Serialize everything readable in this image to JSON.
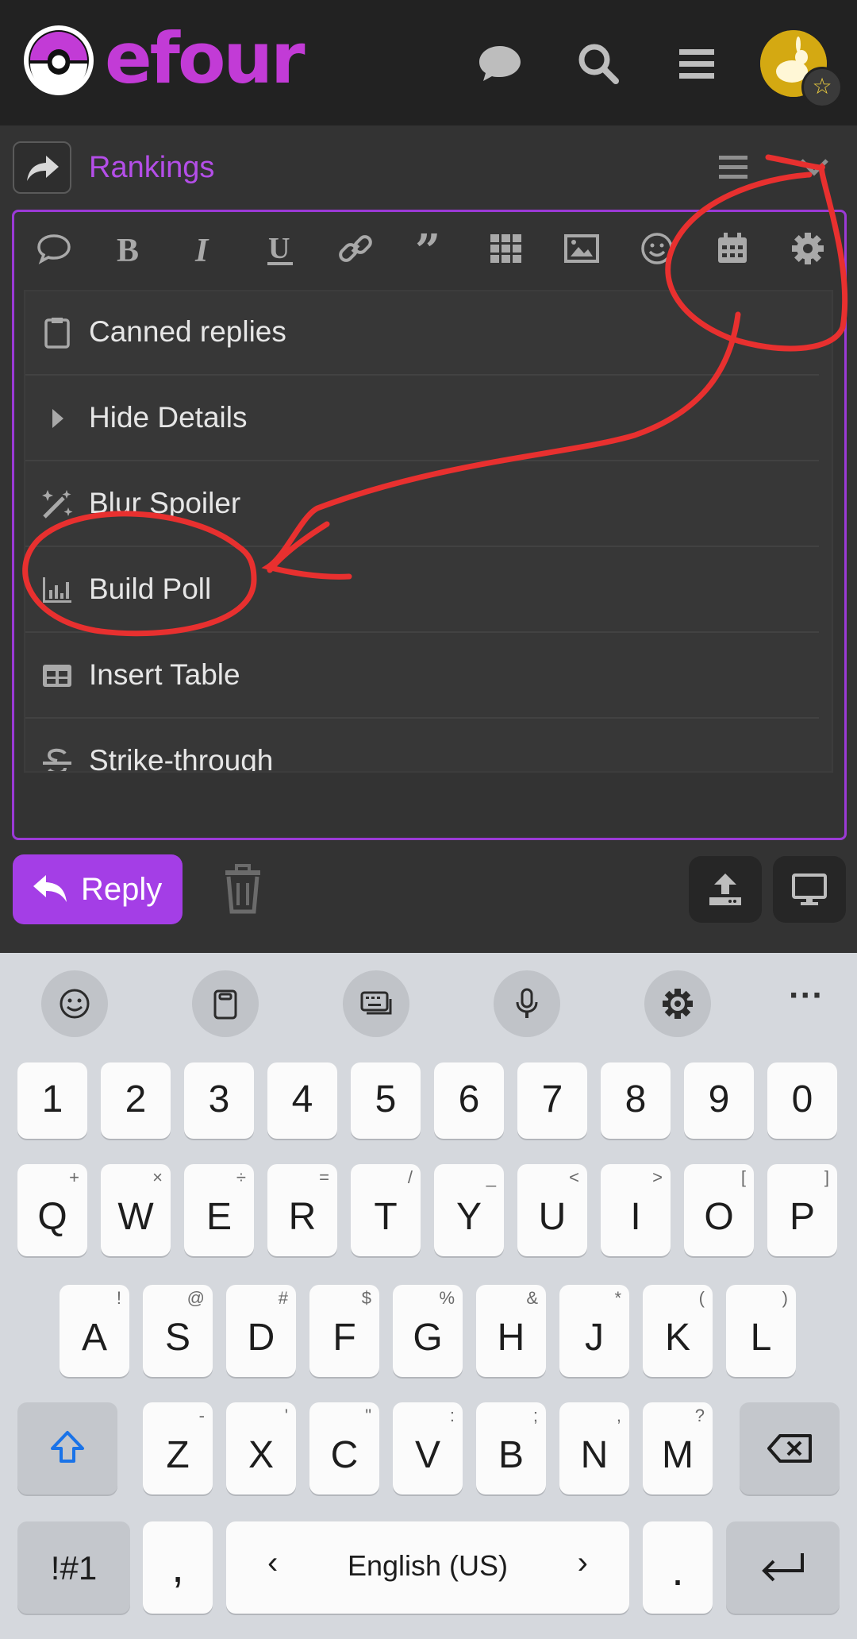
{
  "app": {
    "brand": "efour",
    "topic_title": "Rankings"
  },
  "composer_menu": {
    "items": [
      {
        "icon": "clipboard-icon",
        "label": "Canned replies"
      },
      {
        "icon": "caret-right-icon",
        "label": "Hide Details"
      },
      {
        "icon": "magic-wand-icon",
        "label": "Blur Spoiler"
      },
      {
        "icon": "bar-chart-icon",
        "label": "Build Poll"
      },
      {
        "icon": "table-icon",
        "label": "Insert Table"
      },
      {
        "icon": "strikethrough-icon",
        "label": "Strike-through"
      }
    ]
  },
  "actions": {
    "reply_label": "Reply"
  },
  "keyboard": {
    "numbers": [
      "1",
      "2",
      "3",
      "4",
      "5",
      "6",
      "7",
      "8",
      "9",
      "0"
    ],
    "row1": [
      {
        "k": "Q",
        "s": "+"
      },
      {
        "k": "W",
        "s": "×"
      },
      {
        "k": "E",
        "s": "÷"
      },
      {
        "k": "R",
        "s": "="
      },
      {
        "k": "T",
        "s": "/"
      },
      {
        "k": "Y",
        "s": "_"
      },
      {
        "k": "U",
        "s": "<"
      },
      {
        "k": "I",
        "s": ">"
      },
      {
        "k": "O",
        "s": "["
      },
      {
        "k": "P",
        "s": "]"
      }
    ],
    "row2": [
      {
        "k": "A",
        "s": "!"
      },
      {
        "k": "S",
        "s": "@"
      },
      {
        "k": "D",
        "s": "#"
      },
      {
        "k": "F",
        "s": "$"
      },
      {
        "k": "G",
        "s": "%"
      },
      {
        "k": "H",
        "s": "&"
      },
      {
        "k": "J",
        "s": "*"
      },
      {
        "k": "K",
        "s": "("
      },
      {
        "k": "L",
        "s": ")"
      }
    ],
    "row3": [
      {
        "k": "Z",
        "s": "-"
      },
      {
        "k": "X",
        "s": "'"
      },
      {
        "k": "C",
        "s": "\""
      },
      {
        "k": "V",
        "s": ":"
      },
      {
        "k": "B",
        "s": ";"
      },
      {
        "k": "N",
        "s": ","
      },
      {
        "k": "M",
        "s": "?"
      }
    ],
    "symbols_label": "!#1",
    "comma": ",",
    "space_label": "English (US)",
    "period": ".",
    "more": "···"
  },
  "colors": {
    "accent": "#a43ee6",
    "annotation": "#e8302f"
  }
}
